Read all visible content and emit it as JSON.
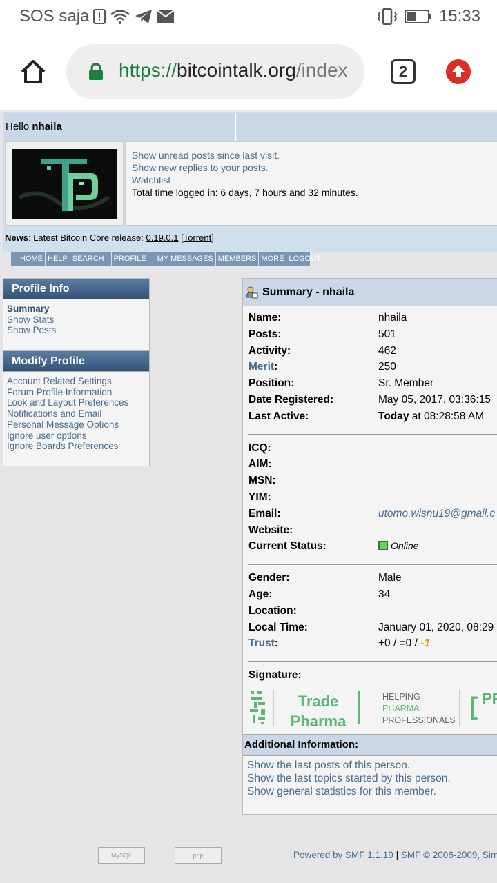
{
  "status_bar": {
    "carrier": "SOS saja",
    "time": "15:33",
    "icons": [
      "alert-icon",
      "wifi-icon",
      "telegram-icon",
      "mail-icon",
      "vibrate-icon",
      "battery-icon"
    ]
  },
  "browser": {
    "url_scheme": "https://",
    "url_host": "bitcointalk.org",
    "url_path": "/index",
    "tab_count": "2"
  },
  "header": {
    "hello": "Hello",
    "username": "nhaila",
    "links": [
      "Show unread posts since last visit.",
      "Show new replies to your posts.",
      "Watchlist"
    ],
    "time_logged": "Total time logged in: 6 days, 7 hours and 32 minutes.",
    "news_label": "News",
    "news_text": ": Latest Bitcoin Core release: ",
    "news_version": "0.19.0.1",
    "news_torrent": "Torrent"
  },
  "menu": [
    "HOME",
    "HELP",
    "SEARCH",
    "PROFILE",
    "MY MESSAGES",
    "MEMBERS",
    "MORE",
    "LOGOUT"
  ],
  "profile_info": {
    "title": "Profile Info",
    "items": [
      "Summary",
      "Show Stats",
      "Show Posts"
    ]
  },
  "modify_profile": {
    "title": "Modify Profile",
    "items": [
      "Account Related Settings",
      "Forum Profile Information",
      "Look and Layout Preferences",
      "Notifications and Email",
      "Personal Message Options",
      "Ignore user options",
      "Ignore Boards Preferences"
    ]
  },
  "summary": {
    "title": "Summary - nhaila",
    "name_label": "Name:",
    "name": "nhaila",
    "posts_label": "Posts:",
    "posts": "501",
    "activity_label": "Activity:",
    "activity": "462",
    "merit_label": "Merit",
    "merit": "250",
    "position_label": "Position:",
    "position": "Sr. Member",
    "registered_label": "Date Registered:",
    "registered": "May 05, 2017, 03:36:15",
    "last_active_label": "Last Active:",
    "last_active_bold": "Today",
    "last_active_rest": " at 08:28:58 AM",
    "icq_label": "ICQ:",
    "aim_label": "AIM:",
    "msn_label": "MSN:",
    "yim_label": "YIM:",
    "email_label": "Email:",
    "email": "utomo.wisnu19@gmail.c",
    "website_label": "Website:",
    "status_label": "Current Status:",
    "status": "Online",
    "gender_label": "Gender:",
    "gender": "Male",
    "age_label": "Age:",
    "age": "34",
    "location_label": "Location:",
    "local_time_label": "Local Time:",
    "local_time": "January 01, 2020, 08:29",
    "trust_label": "Trust",
    "trust_main": "+0 / =0 / ",
    "trust_neg": "-1",
    "signature_label": "Signature:"
  },
  "signature": {
    "trade": "Trade Pharma",
    "help_1": "HELPING",
    "help_2": "PHARMA",
    "help_3": "PROFESSIONALS",
    "bracket": "[",
    "pp": "PF"
  },
  "additional": {
    "title": "Additional Information:",
    "links": [
      "Show the last posts of this person.",
      "Show the last topics started by this person.",
      "Show general statistics for this member."
    ]
  },
  "footer": {
    "mysql_badge": "MySQL",
    "php_badge": "php",
    "powered": "Powered by SMF 1.1.19",
    "sep": " | ",
    "copyright": "SMF © 2006-2009, Sim"
  }
}
